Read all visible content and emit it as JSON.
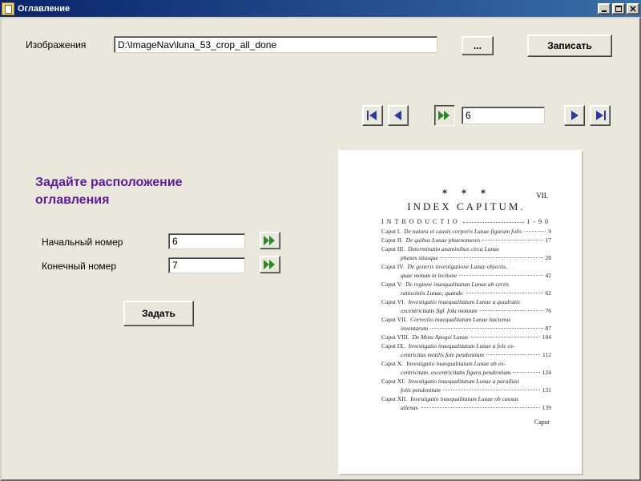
{
  "window": {
    "title": "Оглавление"
  },
  "top": {
    "images_label": "Изображения",
    "path_value": "D:\\ImageNav\\luna_53_crop_all_done",
    "browse_label": "...",
    "save_label": "Записать"
  },
  "nav": {
    "page_value": "6"
  },
  "heading": {
    "line1": "Задайте расположение",
    "line2": "оглавления"
  },
  "range": {
    "start_label": "Начальный номер",
    "start_value": "6",
    "end_label": "Конечный номер",
    "end_value": "7",
    "set_label": "Задать"
  },
  "preview": {
    "cornernum": "VII.",
    "ornament": "✶ ✶ ✶",
    "title": "INDEX CAPITUM.",
    "intro_label": "INTRODUCTIO",
    "intro_page": "1-90",
    "entries": [
      {
        "head": "Caput I.",
        "body": "De natura et causis corporis Lunae figuram folis",
        "page": "9"
      },
      {
        "head": "Caput II.",
        "body": "De quibus Lunae phaenomenis",
        "page": "17"
      },
      {
        "head": "Caput III.",
        "body": "Determinatio axaminibus circa Lunae",
        "cont": "phases situsque",
        "page": "28"
      },
      {
        "head": "Caput IV.",
        "body": "De generis investigatione Lunae objectis,",
        "cont": "quae motum in lectione",
        "page": "42"
      },
      {
        "head": "Caput V.",
        "body": "De regione inaequalitatum Lunae ab certis",
        "cont": "ratiociniis Lunae, quando",
        "page": "62"
      },
      {
        "head": "Caput VI.",
        "body": "Investigatio inaequalitatum Lunae a quadratis",
        "cont": "excentricitatis figl. fola motuum",
        "page": "76"
      },
      {
        "head": "Caput VII.",
        "body": "Correctio inaequalitatum Lunae hactenus",
        "cont": "inventarum",
        "page": "87"
      },
      {
        "head": "Caput VIII.",
        "body": "De Motu Apogei Lunae",
        "page": "104"
      },
      {
        "head": "Caput IX.",
        "body": "Investigatio inaequalitatum Lunae a fole ex-",
        "cont": "centricitas motilis fole pendentium",
        "page": "112"
      },
      {
        "head": "Caput X.",
        "body": "Investigatio inaequalitatum Lunae ab ex-",
        "cont": "centricitate, excentricitatis figura pendentium",
        "page": "124"
      },
      {
        "head": "Caput XI.",
        "body": "Investigatio inaequalitatum Lunae a parallaxi",
        "cont": "folis pendentium",
        "page": "131"
      },
      {
        "head": "Caput XII.",
        "body": "Investigatio inaequalitatum Lunae ob causas",
        "cont": "alienas",
        "page": "139"
      }
    ],
    "footer": "Caput"
  }
}
